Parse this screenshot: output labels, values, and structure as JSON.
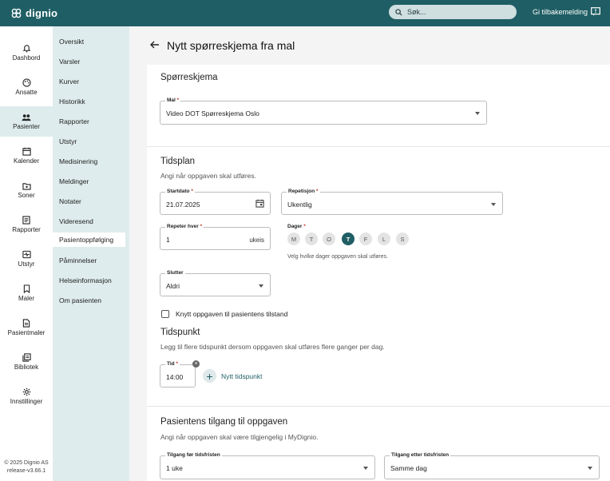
{
  "app": {
    "name": "dignio",
    "search_placeholder": "Søk...",
    "feedback_label": "Gi tilbakemelding"
  },
  "leftnav": {
    "items": [
      {
        "label": "Dashbord",
        "icon": "bell-icon"
      },
      {
        "label": "Ansatte",
        "icon": "palette-icon"
      },
      {
        "label": "Pasienter",
        "icon": "people-icon"
      },
      {
        "label": "Kalender",
        "icon": "calendar-icon"
      },
      {
        "label": "Soner",
        "icon": "folder-icon"
      },
      {
        "label": "Rapporter",
        "icon": "report-icon"
      },
      {
        "label": "Utstyr",
        "icon": "device-icon"
      },
      {
        "label": "Maler",
        "icon": "bookmark-icon"
      },
      {
        "label": "Pasientmaler",
        "icon": "document-icon"
      },
      {
        "label": "Bibliotek",
        "icon": "library-icon"
      },
      {
        "label": "Innstillinger",
        "icon": "gear-icon"
      }
    ],
    "active": "Pasienter",
    "footer_copyright": "© 2025 Dignio AS",
    "footer_release": "release-v3.66.1"
  },
  "subnav": {
    "items": [
      "Oversikt",
      "Varsler",
      "Kurver",
      "Historikk",
      "Rapporter",
      "Utstyr",
      "Medisinering",
      "Meldinger",
      "Notater",
      "Videresend",
      "Pasientoppfølging",
      "Påminnelser",
      "Helseinformasjon",
      "Om pasienten"
    ],
    "active": "Pasientoppfølging"
  },
  "page": {
    "title": "Nytt spørreskjema fra mal"
  },
  "form": {
    "questionnaire": {
      "section_title": "Spørreskjema",
      "template_label": "Mal",
      "template_value": "Video DOT Spørreskjema Oslo"
    },
    "schedule": {
      "section_title": "Tidsplan",
      "helper": "Angi når oppgaven skal utføres.",
      "start_label": "Startdato",
      "start_value": "21.07.2025",
      "repeat_label": "Repetisjon",
      "repeat_value": "Ukentlig",
      "interval_label": "Repeter hver",
      "interval_value": "1",
      "interval_unit": "ukeis",
      "days_label": "Dager",
      "days": [
        {
          "label": "M",
          "selected": false
        },
        {
          "label": "T",
          "selected": false
        },
        {
          "label": "O",
          "selected": false
        },
        {
          "label": "T",
          "selected": true
        },
        {
          "label": "F",
          "selected": false
        },
        {
          "label": "L",
          "selected": false
        },
        {
          "label": "S",
          "selected": false
        }
      ],
      "days_helper": "Velg hvilke dager oppgaven skal utføres.",
      "ends_label": "Slutter",
      "ends_value": "Aldri",
      "link_condition_label": "Knytt oppgaven til pasientens tilstand"
    },
    "time": {
      "section_title": "Tidspunkt",
      "helper": "Legg til flere tidspunkt dersom oppgaven skal utføres flere ganger per dag.",
      "time_label": "Tid",
      "time_value": "14:00",
      "add_label": "Nytt tidspunkt"
    },
    "access": {
      "section_title": "Pasientens tilgang til oppgaven",
      "helper": "Angi når oppgaven skal være tilgjengelig i MyDignio.",
      "before_label": "Tilgang før tidsfristen",
      "before_value": "1 uke",
      "after_label": "Tilgang etter tidsfristen",
      "after_value": "Samme dag"
    }
  },
  "colors": {
    "brand": "#1f5e64",
    "subnav_bg": "#dfeced",
    "required": "#c0392b"
  }
}
